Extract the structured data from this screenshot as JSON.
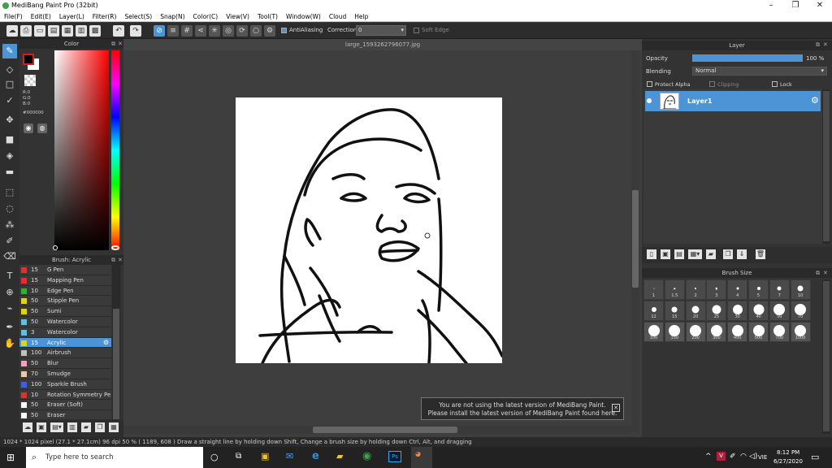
{
  "app": {
    "title": "MediBang Paint Pro (32bit)"
  },
  "menu": [
    "File(F)",
    "Edit(E)",
    "Layer(L)",
    "Filter(R)",
    "Select(S)",
    "Snap(N)",
    "Color(C)",
    "View(V)",
    "Tool(T)",
    "Window(W)",
    "Cloud",
    "Help"
  ],
  "toolbar": {
    "antialiasing": "AntiAliasing",
    "correction_label": "Correction",
    "correction_value": "0",
    "softedge": "Soft Edge"
  },
  "color_panel": {
    "title": "Color",
    "r": "R:0",
    "g": "G:0",
    "b": "B:0",
    "hex": "#000000",
    "fg": "#000000",
    "bg": "#ffffff"
  },
  "brush_panel": {
    "title": "Brush: Acrylic",
    "items": [
      {
        "size": "15",
        "name": "G Pen",
        "color": "#e03030"
      },
      {
        "size": "15",
        "name": "Mapping Pen",
        "color": "#e03030"
      },
      {
        "size": "10",
        "name": "Edge Pen",
        "color": "#30b030"
      },
      {
        "size": "50",
        "name": "Stipple Pen",
        "color": "#e0d020"
      },
      {
        "size": "50",
        "name": "Sumi",
        "color": "#e0d020"
      },
      {
        "size": "50",
        "name": "Watercolor",
        "color": "#60c0e0"
      },
      {
        "size": "3",
        "name": "Watercolor",
        "color": "#60c0e0"
      },
      {
        "size": "15",
        "name": "Acrylic",
        "color": "#e0d020",
        "selected": true
      },
      {
        "size": "100",
        "name": "Airbrush",
        "color": "#c0c0c0"
      },
      {
        "size": "50",
        "name": "Blur",
        "color": "#f0a0c0"
      },
      {
        "size": "70",
        "name": "Smudge",
        "color": "#f0c8a0"
      },
      {
        "size": "100",
        "name": "Sparkle Brush",
        "color": "#4060e0"
      },
      {
        "size": "10",
        "name": "Rotation Symmetry Pe",
        "color": "#e03030"
      },
      {
        "size": "50",
        "name": "Eraser (Soft)",
        "color": "#ffffff"
      },
      {
        "size": "50",
        "name": "Eraser",
        "color": "#ffffff"
      }
    ]
  },
  "document": {
    "tab": "large_1593262796077.jpg"
  },
  "layer_panel": {
    "title": "Layer",
    "opacity_label": "Opacity",
    "opacity_value": "100 %",
    "opacity": 1.0,
    "blending_label": "Blending",
    "blending_value": "Normal",
    "protect_alpha": "Protect Alpha",
    "clipping": "Clipping",
    "lock": "Lock",
    "layer_name": "Layer1"
  },
  "brushsize_panel": {
    "title": "Brush Size",
    "sizes": [
      "1",
      "1.5",
      "2",
      "3",
      "4",
      "5",
      "7",
      "10",
      "12",
      "15",
      "20",
      "25",
      "30",
      "40",
      "50",
      "70",
      "100",
      "150",
      "200",
      "300",
      "400",
      "500",
      "700",
      "1000"
    ]
  },
  "status": "1024 * 1024 pixel  (27.1 * 27.1cm)  96 dpi  50 %  ( 1189, 608 )  Draw a straight line by holding down Shift, Change a brush size by holding down Ctrl, Alt, and dragging",
  "notice": {
    "line1": "You are not using the latest version of MediBang Paint.",
    "line2": "Please install the latest version of MediBang Paint found here."
  },
  "taskbar": {
    "search": "Type here to search",
    "time": "8:12 PM",
    "date": "6/27/2020",
    "lang": "VIE"
  }
}
